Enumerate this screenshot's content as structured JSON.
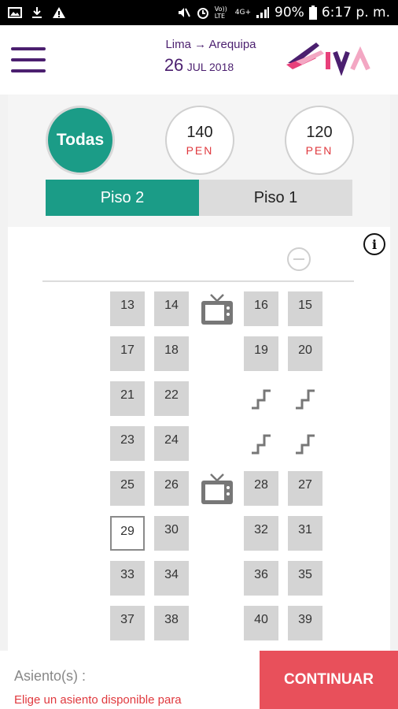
{
  "status_bar": {
    "battery": "90%",
    "time": "6:17 p. m.",
    "network_label": "4G+",
    "volte": "Vo)) LTE"
  },
  "header": {
    "route_origin": "Lima",
    "route_arrow": "→",
    "route_destination": "Arequipa",
    "date_day": "26",
    "date_month_year": "JUL 2018",
    "brand_color": "#4b1f6f",
    "logo_name": "civa-logo"
  },
  "filters": {
    "all_label": "Todas",
    "price_options": [
      {
        "price": "140",
        "currency": "PEN"
      },
      {
        "price": "120",
        "currency": "PEN"
      }
    ],
    "accent_color": "#1b9c87"
  },
  "floors": {
    "tabs": [
      {
        "label": "Piso 2",
        "active": true
      },
      {
        "label": "Piso 1",
        "active": false
      }
    ]
  },
  "seat_map": {
    "rows": [
      {
        "left": [
          "13",
          "14"
        ],
        "middle": "tv-icon",
        "right": [
          "16",
          "15"
        ]
      },
      {
        "left": [
          "17",
          "18"
        ],
        "middle": "",
        "right": [
          "19",
          "20"
        ]
      },
      {
        "left": [
          "21",
          "22"
        ],
        "middle": "",
        "right": [
          "stairs-icon",
          "stairs-icon"
        ]
      },
      {
        "left": [
          "23",
          "24"
        ],
        "middle": "",
        "right": [
          "stairs-icon",
          "stairs-icon"
        ]
      },
      {
        "left": [
          "25",
          "26"
        ],
        "middle": "tv-icon",
        "right": [
          "28",
          "27"
        ]
      },
      {
        "left": [
          "29",
          "30"
        ],
        "middle": "",
        "right": [
          "32",
          "31"
        ]
      },
      {
        "left": [
          "33",
          "34"
        ],
        "middle": "",
        "right": [
          "36",
          "35"
        ]
      },
      {
        "left": [
          "37",
          "38"
        ],
        "middle": "",
        "right": [
          "40",
          "39"
        ]
      }
    ],
    "available_seats": [
      "29"
    ],
    "occupied_color": "#d4d4d4",
    "available_color": "#ffffff"
  },
  "footer": {
    "seats_label": "Asiento(s) :",
    "hint": "Elige un asiento disponible para",
    "continue_label": "CONTINUAR",
    "continue_color": "#e8505b"
  }
}
